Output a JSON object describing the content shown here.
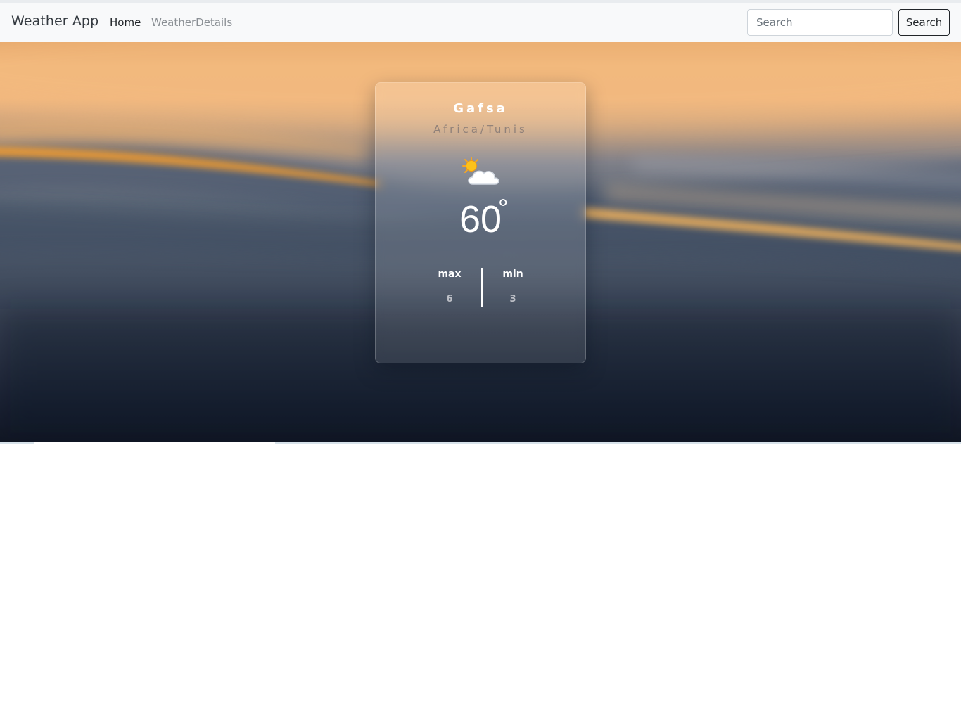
{
  "navbar": {
    "brand": "Weather App",
    "links": [
      {
        "label": "Home"
      },
      {
        "label": "WeatherDetails"
      }
    ],
    "search": {
      "placeholder": "Search",
      "value": "",
      "button_label": "Search"
    }
  },
  "weather": {
    "city": "Gafsa",
    "timezone": "Africa/Tunis",
    "icon": "partly-cloudy-icon",
    "temperature": "60",
    "degree_symbol": "°",
    "max_label": "max",
    "max_value": "6",
    "min_label": "min",
    "min_value": "3"
  },
  "colors": {
    "navbar_bg": "#f8f9fa",
    "sky_orange": "#f0b578",
    "water_dark": "#0e1522"
  }
}
